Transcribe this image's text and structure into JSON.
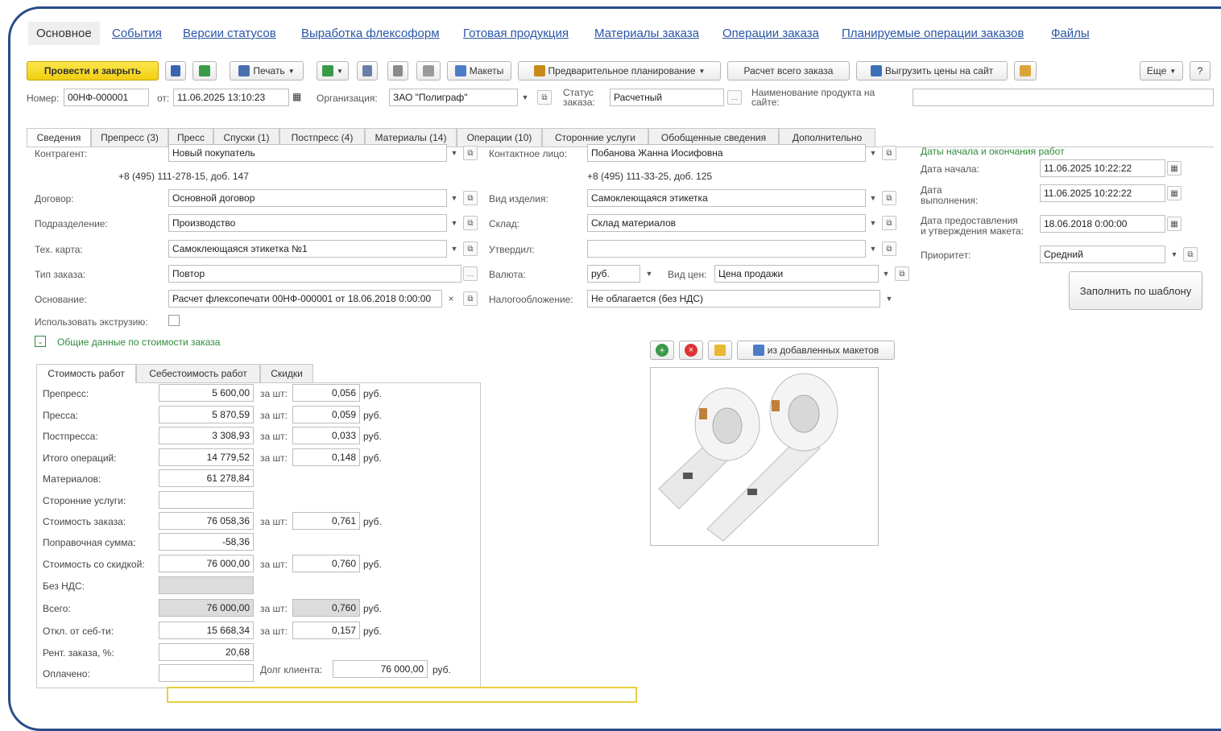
{
  "top_tabs": [
    "Основное",
    "События",
    "Версии статусов",
    "Выработка флексоформ",
    "Готовая продукция",
    "Материалы заказа",
    "Операции заказа",
    "Планируемые операции заказов",
    "Файлы"
  ],
  "toolbar": {
    "post_close": "Провести и закрыть",
    "print": "Печать",
    "layouts": "Макеты",
    "prelim": "Предварительное планирование",
    "calc": "Расчет всего заказа",
    "upload": "Выгрузить цены на сайт",
    "more": "Еще",
    "help": "?"
  },
  "header": {
    "number_label": "Номер:",
    "number": "00НФ-000001",
    "from_label": "от:",
    "date": "11.06.2025 13:10:23",
    "org_label": "Организация:",
    "org": "ЗАО \"Полиграф\"",
    "status_label1": "Статус",
    "status_label2": "заказа:",
    "status": "Расчетный",
    "product_label1": "Наименование продукта на",
    "product_label2": "сайте:",
    "product": ""
  },
  "form_tabs": [
    "Сведения",
    "Препресс (3)",
    "Пресс",
    "Спуски (1)",
    "Постпресс (4)",
    "Материалы (14)",
    "Операции (10)",
    "Сторонние услуги",
    "Обобщенные сведения",
    "Дополнительно"
  ],
  "fields": {
    "contractor_label": "Контрагент:",
    "contractor": "Новый покупатель",
    "contractor_phone": "+8 (495) 111-278-15, доб. 147",
    "contact_label": "Контактное лицо:",
    "contact": "Побанова Жанна Иосифовна",
    "contact_phone": "+8 (495) 111-33-25, доб. 125",
    "contract_label": "Договор:",
    "contract": "Основной договор",
    "product_kind_label": "Вид изделия:",
    "product_kind": "Самоклеющаяся этикетка",
    "division_label": "Подразделение:",
    "division": "Производство",
    "warehouse_label": "Склад:",
    "warehouse": "Склад материалов",
    "techcard_label": "Тех. карта:",
    "techcard": "Самоклеющаяся этикетка №1",
    "approved_label": "Утвердил:",
    "approved": "",
    "ordertype_label": "Тип заказа:",
    "ordertype": "Повтор",
    "currency_label": "Валюта:",
    "currency": "руб.",
    "pricetype_label": "Вид цен:",
    "pricetype": "Цена продажи",
    "basis_label": "Основание:",
    "basis": "Расчет флексопечати 00НФ-000001 от 18.06.2018 0:00:00",
    "tax_label": "Налогообложение:",
    "tax": "Не облагается (без НДС)",
    "extrusion_label": "Использовать экструзию:",
    "cost_group": "Общие данные по стоимости заказа"
  },
  "dates": {
    "title": "Даты начала и окончания работ",
    "start_label": "Дата начала:",
    "start": "11.06.2025 10:22:22",
    "finish_label1": "Дата",
    "finish_label2": "выполнения:",
    "finish": "11.06.2025 10:22:22",
    "approve_label1": "Дата предоставления",
    "approve_label2": "и утверждения макета:",
    "approve": "18.06.2018 0:00:00",
    "priority_label": "Приоритет:",
    "priority": "Средний",
    "fill_template": "Заполнить по шаблону"
  },
  "cost_tabs": [
    "Стоимость работ",
    "Себестоимость работ",
    "Скидки"
  ],
  "cost_rows": [
    {
      "label": "Препресс:",
      "value": "5 600,00",
      "per": "за шт:",
      "unit": "0,056",
      "cur": "руб."
    },
    {
      "label": "Пресса:",
      "value": "5 870,59",
      "per": "за шт:",
      "unit": "0,059",
      "cur": "руб."
    },
    {
      "label": "Постпресса:",
      "value": "3 308,93",
      "per": "за шт:",
      "unit": "0,033",
      "cur": "руб."
    },
    {
      "label": "Итого операций:",
      "value": "14 779,52",
      "per": "за шт:",
      "unit": "0,148",
      "cur": "руб."
    },
    {
      "label": "Материалов:",
      "value": "61 278,84",
      "per": "",
      "unit": "",
      "cur": ""
    },
    {
      "label": "Сторонние услуги:",
      "value": "",
      "per": "",
      "unit": "",
      "cur": ""
    },
    {
      "label": "Стоимость заказа:",
      "value": "76 058,36",
      "per": "за шт:",
      "unit": "0,761",
      "cur": "руб."
    },
    {
      "label": "Поправочная сумма:",
      "value": "-58,36",
      "per": "",
      "unit": "",
      "cur": ""
    },
    {
      "label": "Стоимость со скидкой:",
      "value": "76 000,00",
      "per": "за шт:",
      "unit": "0,760",
      "cur": "руб."
    },
    {
      "label": "Без НДС:",
      "value": "",
      "per": "",
      "unit": "",
      "cur": ""
    },
    {
      "label": "Всего:",
      "value": "76 000,00",
      "per": "за шт:",
      "unit": "0,760",
      "cur": "руб."
    },
    {
      "label": "Откл. от себ-ти:",
      "value": "15 668,34",
      "per": "за шт:",
      "unit": "0,157",
      "cur": "руб."
    },
    {
      "label": "Рент. заказа, %:",
      "value": "20,68",
      "per": "",
      "unit": "",
      "cur": ""
    },
    {
      "label": "Оплачено:",
      "value": "",
      "per": "",
      "unit": "",
      "cur": ""
    }
  ],
  "debt": {
    "label": "Долг клиента:",
    "value": "76 000,00",
    "cur": "руб."
  },
  "image_panel": {
    "from_layouts": "из добавленных макетов"
  },
  "colors": {
    "accent": "#2a55a5",
    "primary_button": "#f1cf12",
    "green": "#2e8b3c",
    "frame": "#2a4a8a"
  }
}
